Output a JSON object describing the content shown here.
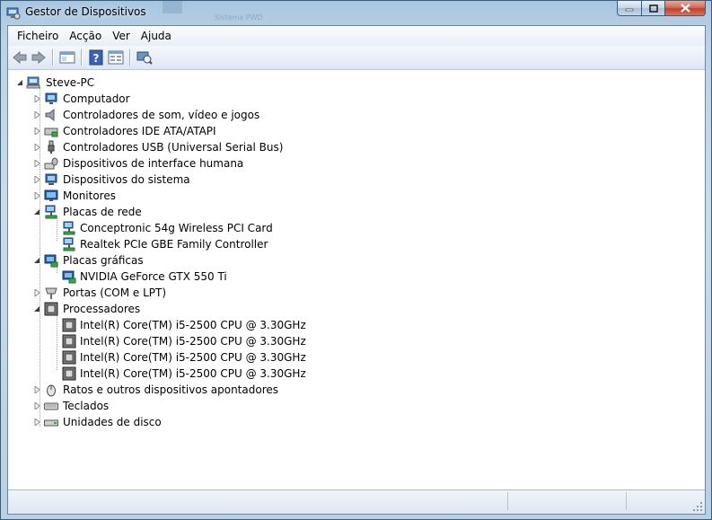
{
  "window": {
    "title": "Gestor de Dispositivos",
    "controls": {
      "minimize_icon": "minimize-icon",
      "maximize_icon": "maximize-icon",
      "close_icon": "close-icon"
    }
  },
  "background": {
    "label": "Sistema PWD"
  },
  "menu": [
    "Ficheiro",
    "Acção",
    "Ver",
    "Ajuda"
  ],
  "toolbar": [
    "back-arrow-icon",
    "forward-arrow-icon",
    "show-hide-console-tree-icon",
    "help-icon",
    "properties-icon",
    "scan-hardware-icon"
  ],
  "tree": {
    "root": "Steve-PC",
    "categories": [
      {
        "label": "Computador",
        "icon": "computer-icon",
        "expanded": false
      },
      {
        "label": "Controladores de som, vídeo e jogos",
        "icon": "speaker-icon",
        "expanded": false
      },
      {
        "label": "Controladores IDE ATA/ATAPI",
        "icon": "ide-controller-icon",
        "expanded": false
      },
      {
        "label": "Controladores USB (Universal Serial Bus)",
        "icon": "usb-icon",
        "expanded": false
      },
      {
        "label": "Dispositivos de interface humana",
        "icon": "hid-icon",
        "expanded": false
      },
      {
        "label": "Dispositivos do sistema",
        "icon": "system-device-icon",
        "expanded": false
      },
      {
        "label": "Monitores",
        "icon": "monitor-icon",
        "expanded": false
      },
      {
        "label": "Placas de rede",
        "icon": "network-adapter-icon",
        "expanded": true,
        "children": [
          "Conceptronic 54g Wireless PCI Card",
          "Realtek PCIe GBE Family Controller"
        ]
      },
      {
        "label": "Placas gráficas",
        "icon": "display-adapter-icon",
        "expanded": true,
        "children": [
          "NVIDIA GeForce GTX 550 Ti"
        ]
      },
      {
        "label": "Portas (COM e LPT)",
        "icon": "port-icon",
        "expanded": false
      },
      {
        "label": "Processadores",
        "icon": "processor-icon",
        "expanded": true,
        "children": [
          "Intel(R) Core(TM) i5-2500 CPU @ 3.30GHz",
          "Intel(R) Core(TM) i5-2500 CPU @ 3.30GHz",
          "Intel(R) Core(TM) i5-2500 CPU @ 3.30GHz",
          "Intel(R) Core(TM) i5-2500 CPU @ 3.30GHz"
        ]
      },
      {
        "label": "Ratos e outros dispositivos apontadores",
        "icon": "mouse-icon",
        "expanded": false
      },
      {
        "label": "Teclados",
        "icon": "keyboard-icon",
        "expanded": false
      },
      {
        "label": "Unidades de disco",
        "icon": "disk-drive-icon",
        "expanded": false
      }
    ]
  },
  "statusbar": {
    "text": ""
  }
}
